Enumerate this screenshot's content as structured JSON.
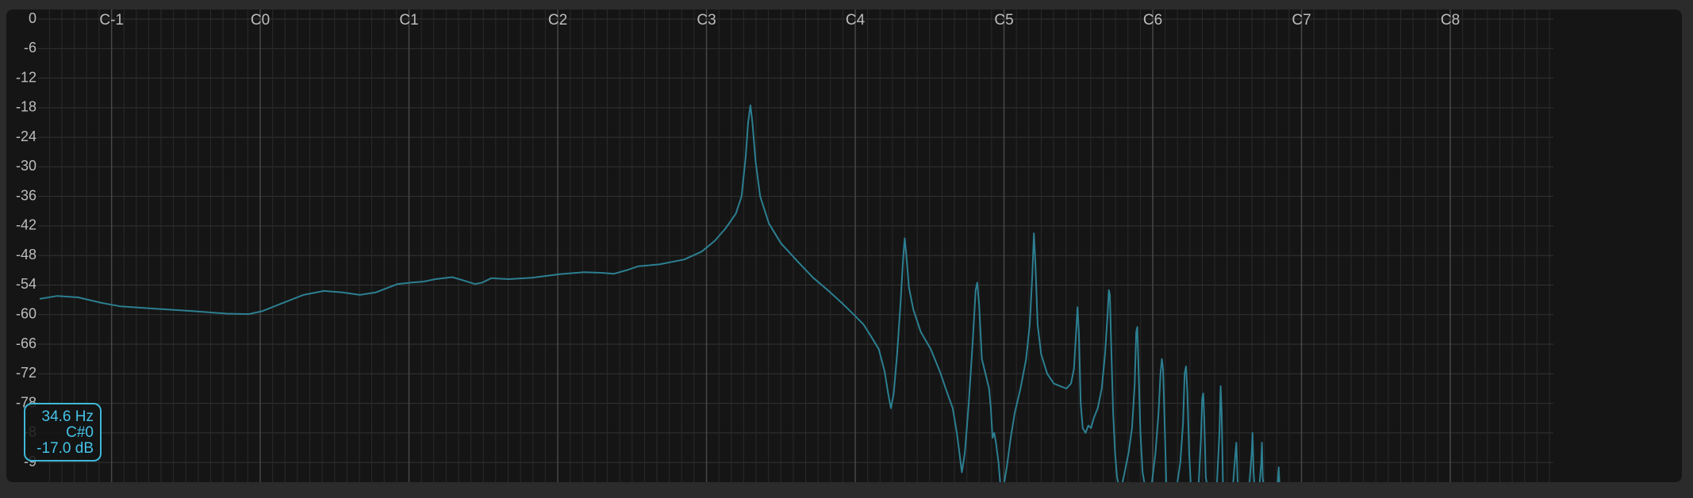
{
  "chart_data": {
    "type": "line",
    "title": "",
    "xlabel": "",
    "ylabel": "",
    "x_axis": {
      "scale": "log-frequency",
      "tick_labels": [
        "C-1",
        "C0",
        "C1",
        "C2",
        "C3",
        "C4",
        "C5",
        "C6",
        "C7",
        "C8"
      ],
      "tick_hz": [
        8.18,
        16.35,
        32.7,
        65.41,
        130.81,
        261.63,
        523.25,
        1046.5,
        2093,
        4186
      ]
    },
    "y_axis": {
      "unit": "dB",
      "ylim": [
        -94,
        0
      ],
      "ticks": [
        0,
        -6,
        -12,
        -18,
        -24,
        -30,
        -36,
        -42,
        -48,
        -54,
        -60,
        -66,
        -72,
        -78,
        -84,
        -90
      ],
      "tick_labels": [
        "0",
        "-6",
        "-12",
        "-18",
        "-24",
        "-30",
        "-36",
        "-42",
        "-48",
        "-54",
        "-60",
        "-66",
        "-72",
        "-78",
        "-8",
        "-9"
      ]
    },
    "grid": true,
    "series": [
      {
        "name": "",
        "color": "#2c7f91",
        "points": [
          [
            5.85,
            -56.8
          ],
          [
            6.35,
            -56.2
          ],
          [
            7.0,
            -56.5
          ],
          [
            7.8,
            -57.6
          ],
          [
            8.5,
            -58.3
          ],
          [
            10.0,
            -58.8
          ],
          [
            12.0,
            -59.3
          ],
          [
            14.0,
            -59.8
          ],
          [
            15.5,
            -59.9
          ],
          [
            16.5,
            -59.3
          ],
          [
            18.0,
            -57.8
          ],
          [
            20.0,
            -56.0
          ],
          [
            22.0,
            -55.2
          ],
          [
            24.0,
            -55.5
          ],
          [
            26.0,
            -56.0
          ],
          [
            28.0,
            -55.5
          ],
          [
            31.0,
            -53.8
          ],
          [
            33.0,
            -53.5
          ],
          [
            35.0,
            -53.3
          ],
          [
            37.0,
            -52.8
          ],
          [
            40.0,
            -52.4
          ],
          [
            42.0,
            -53.0
          ],
          [
            44.5,
            -53.8
          ],
          [
            46.0,
            -53.5
          ],
          [
            48.0,
            -52.6
          ],
          [
            52.0,
            -52.8
          ],
          [
            58.0,
            -52.5
          ],
          [
            66.0,
            -51.8
          ],
          [
            74.0,
            -51.4
          ],
          [
            80.0,
            -51.5
          ],
          [
            85.0,
            -51.7
          ],
          [
            90.0,
            -51.0
          ],
          [
            95.0,
            -50.2
          ],
          [
            105.0,
            -49.8
          ],
          [
            118.0,
            -48.8
          ],
          [
            128.0,
            -47.2
          ],
          [
            136.0,
            -45.0
          ],
          [
            143.0,
            -42.5
          ],
          [
            150.0,
            -39.5
          ],
          [
            154.0,
            -36.0
          ],
          [
            157.0,
            -28.0
          ],
          [
            158.8,
            -21.0
          ],
          [
            160.5,
            -17.5
          ],
          [
            162.0,
            -21.0
          ],
          [
            164.5,
            -29.0
          ],
          [
            168.0,
            -36.0
          ],
          [
            175.0,
            -41.5
          ],
          [
            185.0,
            -45.5
          ],
          [
            200.0,
            -49.2
          ],
          [
            215.0,
            -52.5
          ],
          [
            230.0,
            -55.0
          ],
          [
            245.0,
            -57.5
          ],
          [
            260.0,
            -60.0
          ],
          [
            272.0,
            -62.0
          ],
          [
            282.0,
            -64.5
          ],
          [
            292.0,
            -67.0
          ],
          [
            300.0,
            -71.5
          ],
          [
            305.0,
            -76.0
          ],
          [
            309.0,
            -79.0
          ],
          [
            313.0,
            -76.0
          ],
          [
            318.0,
            -68.0
          ],
          [
            323.0,
            -58.0
          ],
          [
            327.0,
            -48.5
          ],
          [
            329.5,
            -44.5
          ],
          [
            332.0,
            -48.0
          ],
          [
            336.0,
            -54.5
          ],
          [
            343.0,
            -59.0
          ],
          [
            355.0,
            -63.5
          ],
          [
            372.0,
            -67.0
          ],
          [
            388.0,
            -71.5
          ],
          [
            402.0,
            -76.0
          ],
          [
            412.0,
            -79.0
          ],
          [
            420.0,
            -84.0
          ],
          [
            425.0,
            -88.0
          ],
          [
            430.0,
            -92.0
          ],
          [
            436.0,
            -88.0
          ],
          [
            444.0,
            -78.0
          ],
          [
            452.0,
            -66.0
          ],
          [
            458.5,
            -55.0
          ],
          [
            462.0,
            -53.5
          ],
          [
            466.0,
            -58.0
          ],
          [
            472.0,
            -69.0
          ],
          [
            480.0,
            -72.0
          ],
          [
            488.0,
            -75.0
          ],
          [
            492.0,
            -79.0
          ],
          [
            496.0,
            -85.0
          ],
          [
            500.0,
            -84.0
          ],
          [
            504.0,
            -86.0
          ],
          [
            510.0,
            -90.0
          ],
          [
            515.0,
            -95.0
          ],
          [
            522.0,
            -95.0
          ],
          [
            530.0,
            -91.0
          ],
          [
            540.0,
            -85.0
          ],
          [
            550.0,
            -80.0
          ],
          [
            565.0,
            -75.0
          ],
          [
            580.0,
            -69.0
          ],
          [
            590.0,
            -62.0
          ],
          [
            597.0,
            -52.0
          ],
          [
            601.5,
            -43.5
          ],
          [
            606.0,
            -50.0
          ],
          [
            612.0,
            -62.0
          ],
          [
            622.0,
            -68.0
          ],
          [
            640.0,
            -72.0
          ],
          [
            660.0,
            -74.0
          ],
          [
            680.0,
            -74.5
          ],
          [
            700.0,
            -75.0
          ],
          [
            715.0,
            -74.0
          ],
          [
            725.0,
            -71.0
          ],
          [
            732.0,
            -64.0
          ],
          [
            737.0,
            -58.5
          ],
          [
            742.0,
            -64.0
          ],
          [
            748.0,
            -78.0
          ],
          [
            755.0,
            -83.0
          ],
          [
            765.0,
            -84.0
          ],
          [
            775.0,
            -82.5
          ],
          [
            785.0,
            -83.0
          ],
          [
            795.0,
            -81.0
          ],
          [
            810.0,
            -79.0
          ],
          [
            825.0,
            -75.0
          ],
          [
            838.0,
            -68.0
          ],
          [
            848.0,
            -60.0
          ],
          [
            853.0,
            -55.0
          ],
          [
            857.0,
            -56.0
          ],
          [
            862.0,
            -66.0
          ],
          [
            870.0,
            -80.0
          ],
          [
            878.0,
            -88.0
          ],
          [
            886.0,
            -93.0
          ],
          [
            895.0,
            -95.0
          ],
          [
            905.0,
            -95.0
          ],
          [
            918.0,
            -92.0
          ],
          [
            935.0,
            -88.0
          ],
          [
            950.0,
            -83.0
          ],
          [
            962.0,
            -74.0
          ],
          [
            969.0,
            -63.5
          ],
          [
            974.0,
            -62.5
          ],
          [
            980.0,
            -72.0
          ],
          [
            988.0,
            -84.0
          ],
          [
            998.0,
            -92.0
          ],
          [
            1010.0,
            -95.0
          ],
          [
            1040.0,
            -95.0
          ],
          [
            1060.0,
            -88.0
          ],
          [
            1075.0,
            -80.0
          ],
          [
            1085.0,
            -72.0
          ],
          [
            1092.0,
            -69.0
          ],
          [
            1098.0,
            -71.0
          ],
          [
            1106.0,
            -82.0
          ],
          [
            1115.0,
            -95.0
          ],
          [
            1170.0,
            -95.0
          ],
          [
            1190.0,
            -90.0
          ],
          [
            1205.0,
            -82.0
          ],
          [
            1214.0,
            -72.0
          ],
          [
            1222.0,
            -70.5
          ],
          [
            1230.0,
            -76.0
          ],
          [
            1240.0,
            -88.0
          ],
          [
            1250.0,
            -95.0
          ],
          [
            1295.0,
            -95.0
          ],
          [
            1310.0,
            -85.0
          ],
          [
            1318.0,
            -77.0
          ],
          [
            1324.0,
            -76.0
          ],
          [
            1330.0,
            -81.0
          ],
          [
            1340.0,
            -93.0
          ],
          [
            1350.0,
            -95.0
          ],
          [
            1410.0,
            -95.0
          ],
          [
            1428.0,
            -84.0
          ],
          [
            1436.0,
            -74.5
          ],
          [
            1443.0,
            -80.0
          ],
          [
            1452.0,
            -95.0
          ],
          [
            1520.0,
            -95.0
          ],
          [
            1536.0,
            -89.0
          ],
          [
            1545.0,
            -86.0
          ],
          [
            1555.0,
            -95.0
          ],
          [
            1640.0,
            -95.0
          ],
          [
            1660.0,
            -88.0
          ],
          [
            1666.0,
            -84.0
          ],
          [
            1674.0,
            -92.0
          ],
          [
            1682.0,
            -95.0
          ],
          [
            1720.0,
            -95.0
          ],
          [
            1735.0,
            -90.0
          ],
          [
            1740.0,
            -86.0
          ],
          [
            1747.0,
            -93.0
          ],
          [
            1755.0,
            -95.0
          ],
          [
            1870.0,
            -95.0
          ],
          [
            1882.0,
            -91.0
          ],
          [
            1890.0,
            -95.0
          ]
        ]
      }
    ],
    "cursor": {
      "frequency": "34.6 Hz",
      "note": "C#0",
      "level": "-17.0 dB"
    },
    "legend": "none"
  }
}
